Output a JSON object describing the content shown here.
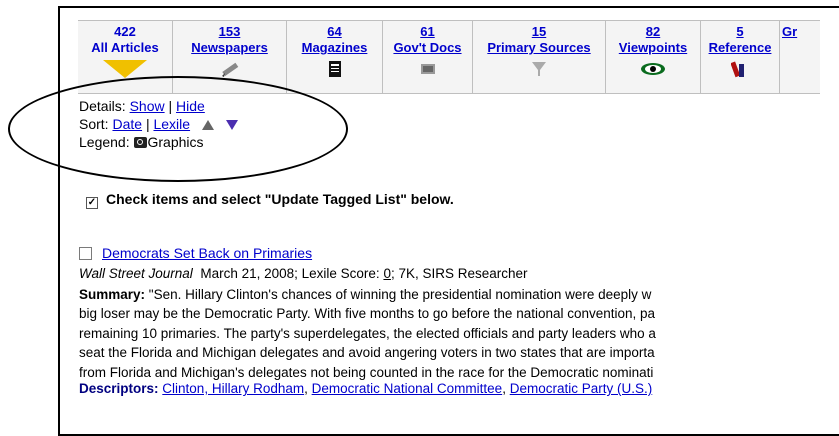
{
  "tabs": [
    {
      "count": "422",
      "label": "All Articles",
      "icon": "selected-arrow-icon",
      "active": true
    },
    {
      "count": "153",
      "label": "Newspapers",
      "icon": "pencil-icon"
    },
    {
      "count": "64",
      "label": "Magazines",
      "icon": "magazine-icon"
    },
    {
      "count": "61",
      "label": "Gov't Docs",
      "icon": "government-doc-icon"
    },
    {
      "count": "15",
      "label": "Primary Sources",
      "icon": "primary-source-icon"
    },
    {
      "count": "82",
      "label": "Viewpoints",
      "icon": "eye-icon"
    },
    {
      "count": "5",
      "label": "Reference",
      "icon": "reference-books-icon"
    },
    {
      "count": "",
      "label": "Gr",
      "icon": ""
    }
  ],
  "details": {
    "label": "Details:",
    "show": "Show",
    "sep": "|",
    "hide": "Hide"
  },
  "sort": {
    "label": "Sort:",
    "date": "Date",
    "sep": "|",
    "lexile": "Lexile"
  },
  "legend": {
    "label": "Legend:",
    "graphics": "Graphics"
  },
  "instruction": "Check items and select \"Update Tagged List\" below.",
  "article": {
    "title": "Democrats Set Back on Primaries",
    "source": "Wall Street Journal",
    "meta": "March 21, 2008; Lexile Score: ",
    "lexile_score": "0",
    "meta_rest": "; 7K, SIRS Researcher",
    "summary_label": "Summary:",
    "summary_lines": [
      "\"Sen. Hillary Clinton's chances of winning the presidential nomination were deeply w",
      "big loser may be the Democratic Party. With five months to go before the national convention, pa",
      "remaining 10 primaries. The party's superdelegates, the elected officials and party leaders who a",
      "seat the Florida and Michigan delegates and avoid angering voters in two states that are importa",
      "from Florida and Michigan's delegates not being counted in the race for the Democratic nominati"
    ],
    "descriptors_label": "Descriptors:",
    "descriptors": [
      "Clinton, Hillary Rodham",
      "Democratic National Committee",
      "Democratic Party (U.S.)"
    ]
  },
  "colors": {
    "link": "#0000cc",
    "arrow": "#f0c000",
    "sort_down": "#4b2eb0"
  }
}
